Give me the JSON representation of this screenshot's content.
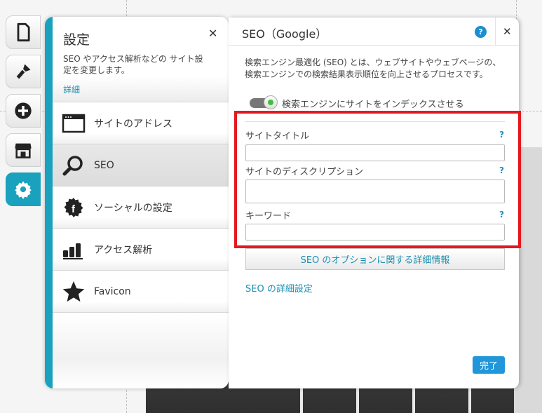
{
  "toolbar": {
    "items": [
      {
        "icon": "page-icon"
      },
      {
        "icon": "brush-icon"
      },
      {
        "icon": "add-icon"
      },
      {
        "icon": "store-icon"
      },
      {
        "icon": "gear-icon"
      }
    ],
    "active_index": 4,
    "accent_color": "#1aa1bd"
  },
  "settings": {
    "title": "設定",
    "description": "SEO やアクセス解析などの サイト設定を変更します。",
    "more_link": "詳細",
    "menu": [
      {
        "label": "サイトのアドレス",
        "icon": "browser-window-icon"
      },
      {
        "label": "SEO",
        "icon": "search-icon"
      },
      {
        "label": "ソーシャルの設定",
        "icon": "social-gear-icon"
      },
      {
        "label": "アクセス解析",
        "icon": "bar-chart-icon"
      },
      {
        "label": "Favicon",
        "icon": "star-icon"
      }
    ],
    "selected_index": 1
  },
  "seo": {
    "title": "SEO（Google）",
    "help": "?",
    "description": "検索エンジン最適化 (SEO) とは、ウェブサイトやウェブページの、検索エンジンでの検索結果表示順位を向上させるプロセスです。",
    "index_toggle": {
      "label": "検索エンジンにサイトをインデックスさせる",
      "enabled": true
    },
    "fields": {
      "site_title": {
        "label": "サイトタイトル",
        "help": "?",
        "value": ""
      },
      "site_description": {
        "label": "サイトのディスクリプション",
        "help": "?",
        "value": ""
      },
      "keywords": {
        "label": "キーワード",
        "help": "?",
        "value": ""
      }
    },
    "options_link": "SEO のオプションに関する詳細情報",
    "advanced_link": "SEO の詳細設定",
    "done_button": "完了",
    "highlight_color": "#e3191f",
    "link_color": "#1a8fb0"
  }
}
